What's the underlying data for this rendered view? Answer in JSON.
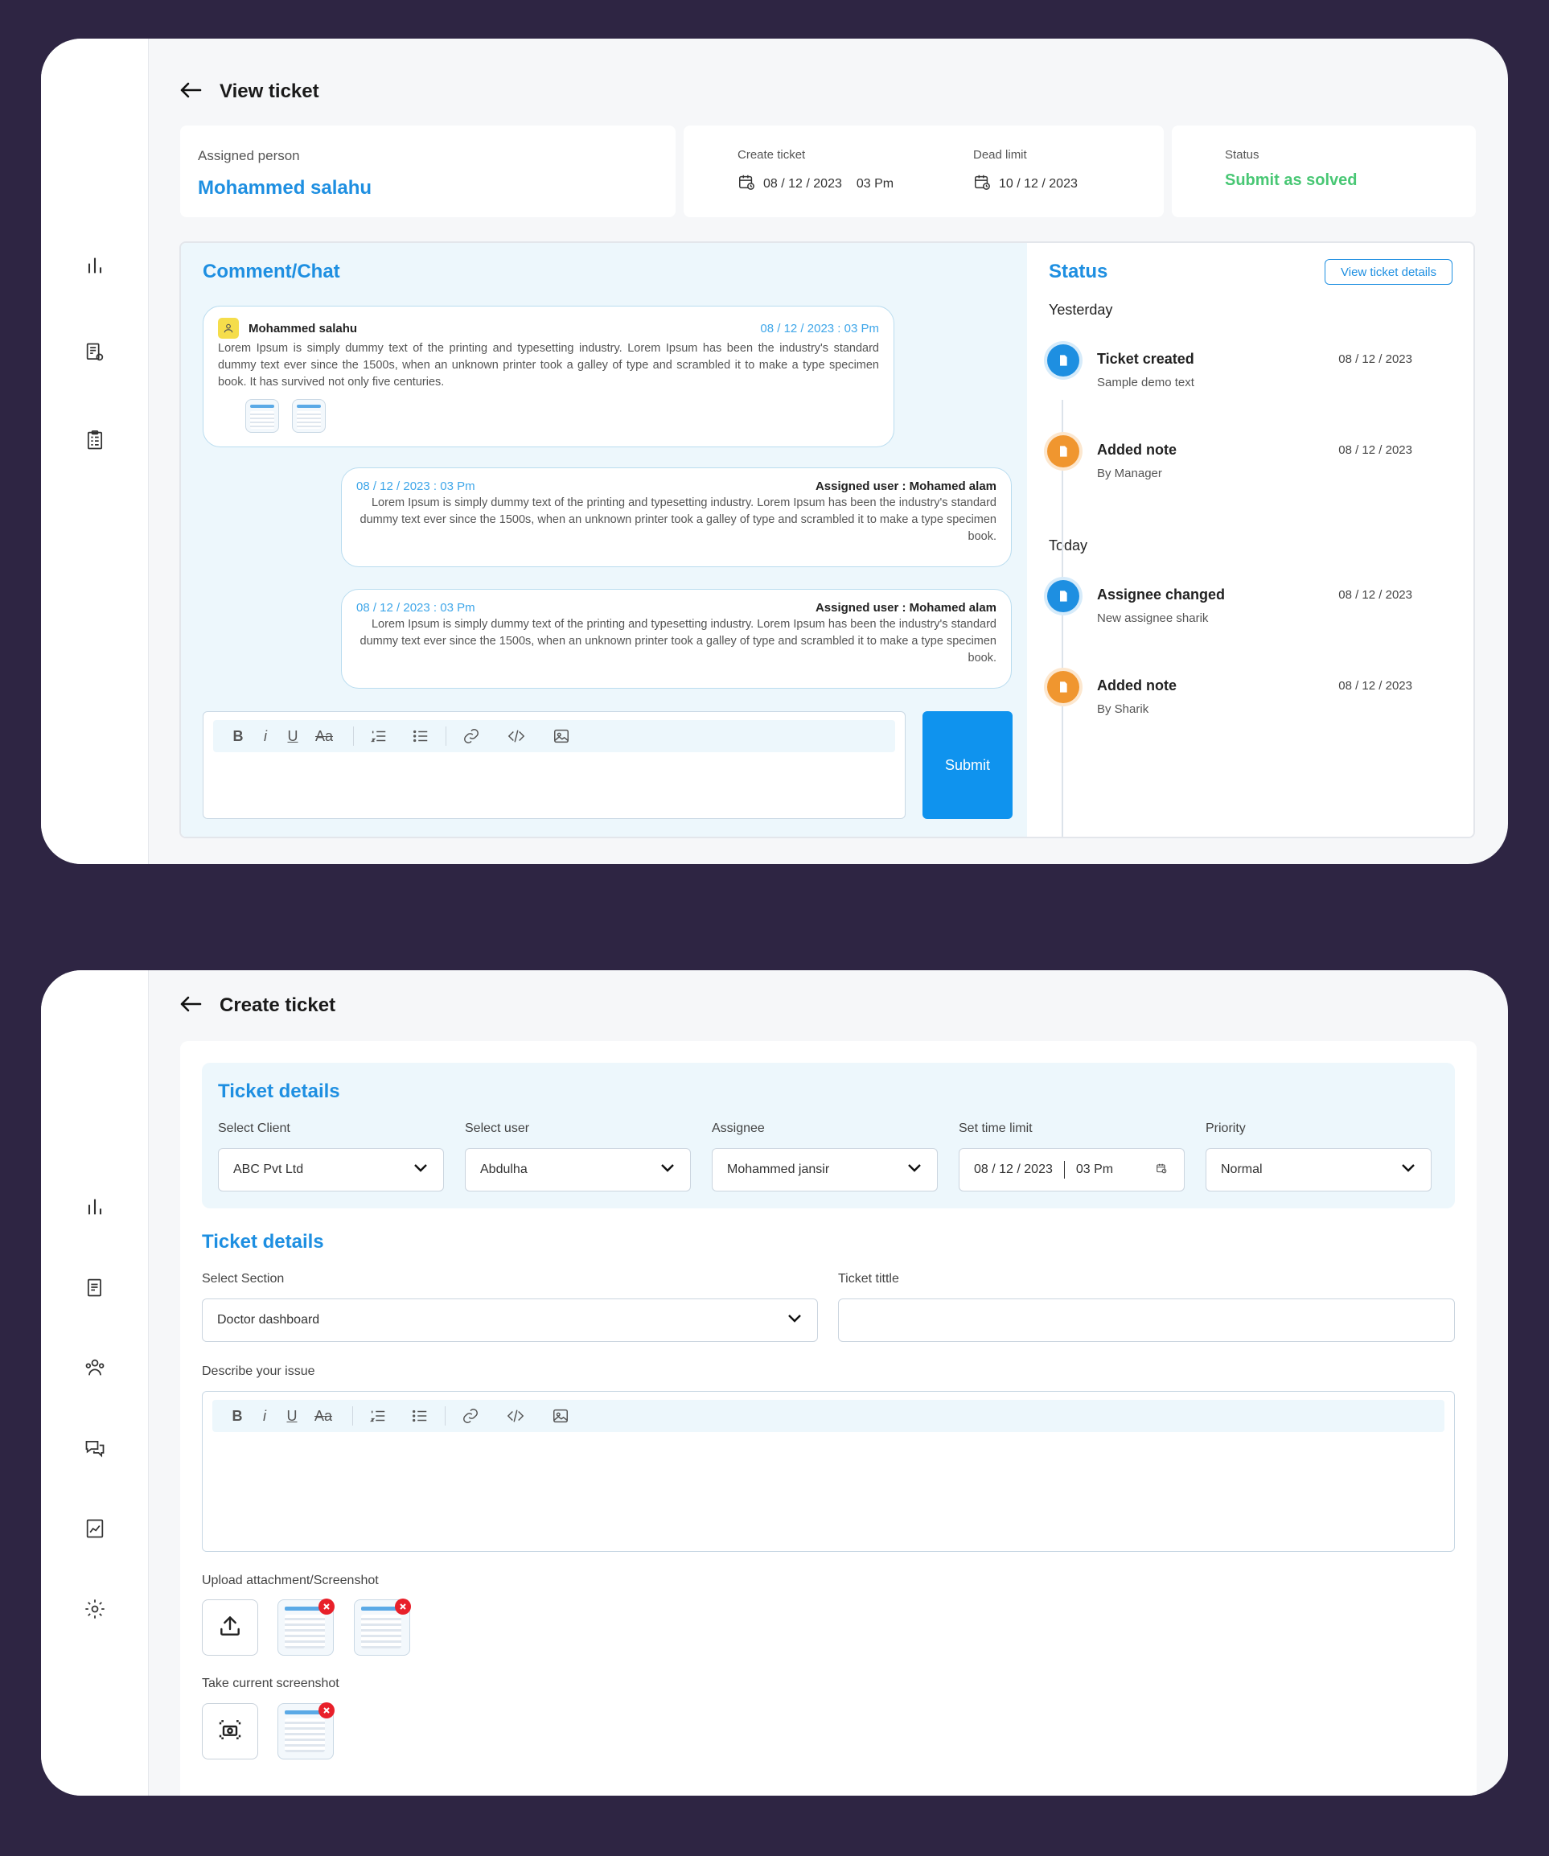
{
  "view": {
    "title": "View ticket",
    "assigned_label": "Assigned person",
    "assigned_name": "Mohammed salahu",
    "create_label": "Create ticket",
    "create_date": "08 / 12 / 2023",
    "create_time": "03 Pm",
    "dead_label": "Dead limit",
    "dead_date": "10 / 12 / 2023",
    "status_label": "Status",
    "status_value": "Submit as solved",
    "chat_title": "Comment/Chat",
    "messages": [
      {
        "author": "Mohammed salahu",
        "time": "08 / 12 / 2023 : 03 Pm",
        "text": "Lorem Ipsum is simply dummy text of the printing and typesetting industry. Lorem Ipsum has been the industry's standard dummy text ever since the 1500s, when an unknown printer took a galley of type and scrambled it to make a type specimen book. It has survived not only five centuries."
      },
      {
        "author": "Assigned user : Mohamed alam",
        "time": "08 / 12 / 2023 : 03 Pm",
        "text": "Lorem Ipsum is simply dummy text of the printing and typesetting industry. Lorem Ipsum has been the industry's standard dummy text ever since the 1500s, when an unknown printer took a galley of type and scrambled it to make a type specimen book."
      },
      {
        "author": "Assigned user : Mohamed alam",
        "time": "08 / 12 / 2023 : 03 Pm",
        "text": "Lorem Ipsum is simply dummy text of the printing and typesetting industry. Lorem Ipsum has been the industry's standard dummy text ever since the 1500s, when an unknown printer took a galley of type and scrambled it to make a type specimen book."
      }
    ],
    "submit_label": "Submit",
    "status_title": "Status",
    "view_details_label": "View ticket details",
    "yesterday_label": "Yesterday",
    "today_label": "Today",
    "timeline": [
      {
        "title": "Ticket created",
        "sub": "Sample demo text",
        "date": "08 / 12 / 2023",
        "color": "#1E8FE1"
      },
      {
        "title": "Added note",
        "sub": "By Manager",
        "date": "08 / 12 / 2023",
        "color": "#F0962F"
      },
      {
        "title": "Assignee changed",
        "sub": "New assignee sharik",
        "date": "08 / 12 / 2023",
        "color": "#1E8FE1"
      },
      {
        "title": "Added note",
        "sub": "By Sharik",
        "date": "08 / 12 / 2023",
        "color": "#F0962F"
      }
    ]
  },
  "create": {
    "title": "Create ticket",
    "details_title": "Ticket details",
    "client_label": "Select Client",
    "client_value": "ABC Pvt Ltd",
    "user_label": "Select user",
    "user_value": "Abdulha",
    "assignee_label": "Assignee",
    "assignee_value": "Mohammed jansir",
    "time_label": "Set time limit",
    "time_date": "08 / 12 / 2023",
    "time_hour": "03 Pm",
    "priority_label": "Priority",
    "priority_value": "Normal",
    "details_title_2": "Ticket details",
    "section_label": "Select Section",
    "section_value": "Doctor dashboard",
    "ticket_title_label": "Ticket tittle",
    "ticket_title_value": "",
    "describe_label": "Describe your issue",
    "upload_label": "Upload attachment/Screenshot",
    "screenshot_label": "Take current screenshot"
  },
  "toolbar": {
    "bold": "B",
    "italic": "i",
    "underline": "U",
    "strike": "Aa"
  },
  "colors": {
    "accent": "#1E8FE1",
    "success": "#48C774",
    "warning": "#F0962F",
    "danger": "#E8202A",
    "background": "#2E2543"
  }
}
